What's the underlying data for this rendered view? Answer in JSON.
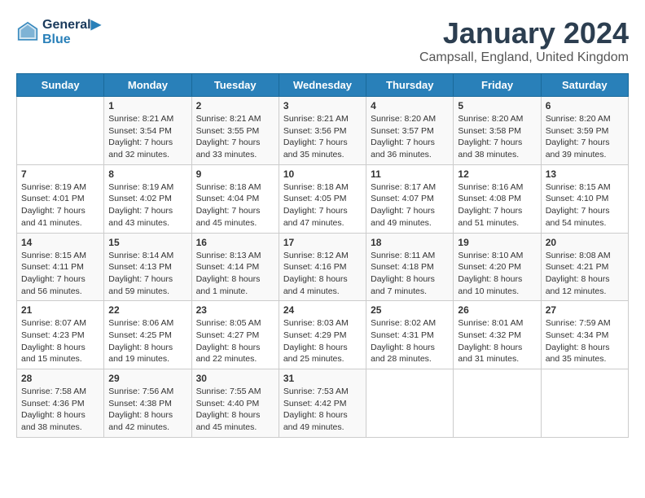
{
  "logo": {
    "line1": "General",
    "line2": "Blue"
  },
  "title": "January 2024",
  "subtitle": "Campsall, England, United Kingdom",
  "weekdays": [
    "Sunday",
    "Monday",
    "Tuesday",
    "Wednesday",
    "Thursday",
    "Friday",
    "Saturday"
  ],
  "weeks": [
    [
      {
        "day": "",
        "info": ""
      },
      {
        "day": "1",
        "info": "Sunrise: 8:21 AM\nSunset: 3:54 PM\nDaylight: 7 hours\nand 32 minutes."
      },
      {
        "day": "2",
        "info": "Sunrise: 8:21 AM\nSunset: 3:55 PM\nDaylight: 7 hours\nand 33 minutes."
      },
      {
        "day": "3",
        "info": "Sunrise: 8:21 AM\nSunset: 3:56 PM\nDaylight: 7 hours\nand 35 minutes."
      },
      {
        "day": "4",
        "info": "Sunrise: 8:20 AM\nSunset: 3:57 PM\nDaylight: 7 hours\nand 36 minutes."
      },
      {
        "day": "5",
        "info": "Sunrise: 8:20 AM\nSunset: 3:58 PM\nDaylight: 7 hours\nand 38 minutes."
      },
      {
        "day": "6",
        "info": "Sunrise: 8:20 AM\nSunset: 3:59 PM\nDaylight: 7 hours\nand 39 minutes."
      }
    ],
    [
      {
        "day": "7",
        "info": "Sunrise: 8:19 AM\nSunset: 4:01 PM\nDaylight: 7 hours\nand 41 minutes."
      },
      {
        "day": "8",
        "info": "Sunrise: 8:19 AM\nSunset: 4:02 PM\nDaylight: 7 hours\nand 43 minutes."
      },
      {
        "day": "9",
        "info": "Sunrise: 8:18 AM\nSunset: 4:04 PM\nDaylight: 7 hours\nand 45 minutes."
      },
      {
        "day": "10",
        "info": "Sunrise: 8:18 AM\nSunset: 4:05 PM\nDaylight: 7 hours\nand 47 minutes."
      },
      {
        "day": "11",
        "info": "Sunrise: 8:17 AM\nSunset: 4:07 PM\nDaylight: 7 hours\nand 49 minutes."
      },
      {
        "day": "12",
        "info": "Sunrise: 8:16 AM\nSunset: 4:08 PM\nDaylight: 7 hours\nand 51 minutes."
      },
      {
        "day": "13",
        "info": "Sunrise: 8:15 AM\nSunset: 4:10 PM\nDaylight: 7 hours\nand 54 minutes."
      }
    ],
    [
      {
        "day": "14",
        "info": "Sunrise: 8:15 AM\nSunset: 4:11 PM\nDaylight: 7 hours\nand 56 minutes."
      },
      {
        "day": "15",
        "info": "Sunrise: 8:14 AM\nSunset: 4:13 PM\nDaylight: 7 hours\nand 59 minutes."
      },
      {
        "day": "16",
        "info": "Sunrise: 8:13 AM\nSunset: 4:14 PM\nDaylight: 8 hours\nand 1 minute."
      },
      {
        "day": "17",
        "info": "Sunrise: 8:12 AM\nSunset: 4:16 PM\nDaylight: 8 hours\nand 4 minutes."
      },
      {
        "day": "18",
        "info": "Sunrise: 8:11 AM\nSunset: 4:18 PM\nDaylight: 8 hours\nand 7 minutes."
      },
      {
        "day": "19",
        "info": "Sunrise: 8:10 AM\nSunset: 4:20 PM\nDaylight: 8 hours\nand 10 minutes."
      },
      {
        "day": "20",
        "info": "Sunrise: 8:08 AM\nSunset: 4:21 PM\nDaylight: 8 hours\nand 12 minutes."
      }
    ],
    [
      {
        "day": "21",
        "info": "Sunrise: 8:07 AM\nSunset: 4:23 PM\nDaylight: 8 hours\nand 15 minutes."
      },
      {
        "day": "22",
        "info": "Sunrise: 8:06 AM\nSunset: 4:25 PM\nDaylight: 8 hours\nand 19 minutes."
      },
      {
        "day": "23",
        "info": "Sunrise: 8:05 AM\nSunset: 4:27 PM\nDaylight: 8 hours\nand 22 minutes."
      },
      {
        "day": "24",
        "info": "Sunrise: 8:03 AM\nSunset: 4:29 PM\nDaylight: 8 hours\nand 25 minutes."
      },
      {
        "day": "25",
        "info": "Sunrise: 8:02 AM\nSunset: 4:31 PM\nDaylight: 8 hours\nand 28 minutes."
      },
      {
        "day": "26",
        "info": "Sunrise: 8:01 AM\nSunset: 4:32 PM\nDaylight: 8 hours\nand 31 minutes."
      },
      {
        "day": "27",
        "info": "Sunrise: 7:59 AM\nSunset: 4:34 PM\nDaylight: 8 hours\nand 35 minutes."
      }
    ],
    [
      {
        "day": "28",
        "info": "Sunrise: 7:58 AM\nSunset: 4:36 PM\nDaylight: 8 hours\nand 38 minutes."
      },
      {
        "day": "29",
        "info": "Sunrise: 7:56 AM\nSunset: 4:38 PM\nDaylight: 8 hours\nand 42 minutes."
      },
      {
        "day": "30",
        "info": "Sunrise: 7:55 AM\nSunset: 4:40 PM\nDaylight: 8 hours\nand 45 minutes."
      },
      {
        "day": "31",
        "info": "Sunrise: 7:53 AM\nSunset: 4:42 PM\nDaylight: 8 hours\nand 49 minutes."
      },
      {
        "day": "",
        "info": ""
      },
      {
        "day": "",
        "info": ""
      },
      {
        "day": "",
        "info": ""
      }
    ]
  ]
}
